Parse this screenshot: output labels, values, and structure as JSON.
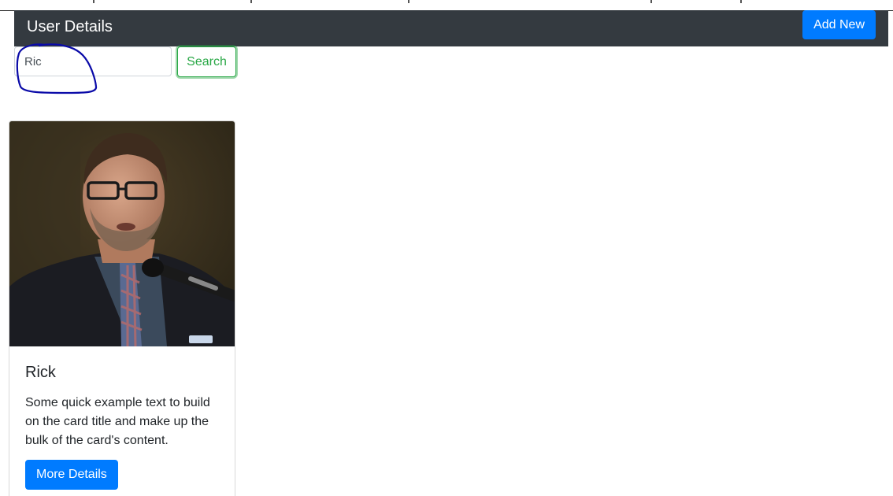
{
  "navbar": {
    "brand": "User Details",
    "add_button_label": "Add New"
  },
  "search": {
    "value": "Ric",
    "button_label": "Search"
  },
  "card": {
    "image_icon": "person-photo",
    "title": "Rick",
    "text": "Some quick example text to build on the card title and make up the bulk of the card's content.",
    "button_label": "More Details"
  },
  "colors": {
    "navbar_bg": "#343a40",
    "primary": "#007bff",
    "success": "#28a745",
    "annotation": "#0a0aa8"
  }
}
